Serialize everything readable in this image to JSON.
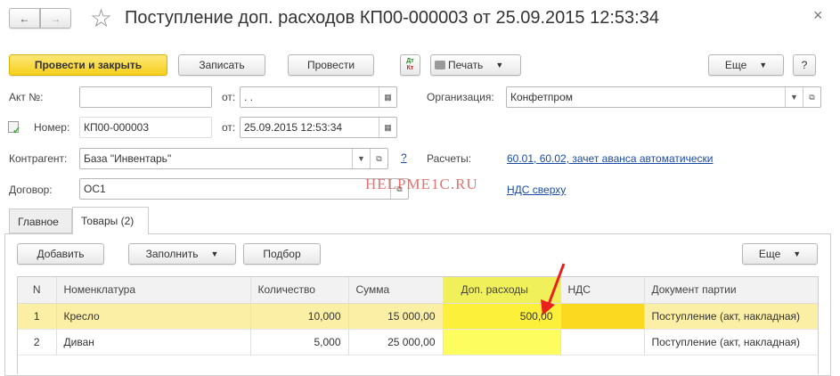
{
  "window": {
    "title": "Поступление доп. расходов КП00-000003 от 25.09.2015 12:53:34",
    "back": "←",
    "forward": "→",
    "star": "☆",
    "close": "×"
  },
  "toolbar": {
    "post_close": "Провести и закрыть",
    "save": "Записать",
    "post": "Провести",
    "dtkt_top": "Дт",
    "dtkt_bottom": "Кт",
    "print": "Печать",
    "more": "Еще",
    "help": "?"
  },
  "form": {
    "act_label": "Акт №:",
    "act_value": "",
    "from_label": "от:",
    "act_date": " .  .",
    "org_label": "Организация:",
    "org_value": "Конфетпром",
    "number_label": "Номер:",
    "number_value": "КП00-000003",
    "date_value": "25.09.2015 12:53:34",
    "contractor_label": "Контрагент:",
    "contractor_value": "База \"Инвентарь\"",
    "question": "?",
    "settlements_label": "Расчеты:",
    "settlements_link": "60.01, 60.02, зачет аванса автоматически",
    "contract_label": "Договор:",
    "contract_value": "ОС1",
    "vat_link": "НДС сверху",
    "watermark": "HELPME1C.RU"
  },
  "tabs": [
    {
      "label": "Главное"
    },
    {
      "label": "Товары (2)",
      "active": true
    }
  ],
  "table_toolbar": {
    "add": "Добавить",
    "fill": "Заполнить",
    "pick": "Подбор",
    "more": "Еще"
  },
  "table": {
    "columns": [
      "N",
      "Номенклатура",
      "Количество",
      "Сумма",
      "Доп. расходы",
      "НДС",
      "Документ партии"
    ],
    "rows": [
      [
        "1",
        "Кресло",
        "10,000",
        "15 000,00",
        "500,00",
        "",
        "Поступление (акт, накладная)"
      ],
      [
        "2",
        "Диван",
        "5,000",
        "25 000,00",
        "",
        "",
        "Поступление (акт, накладная)"
      ]
    ]
  },
  "colors": {
    "accent_yellow": "#fbd92b",
    "selected_row": "#fbefa6",
    "highlight": "#fdfd60",
    "link": "#1a4aa8",
    "arrow": "#e8211f"
  }
}
